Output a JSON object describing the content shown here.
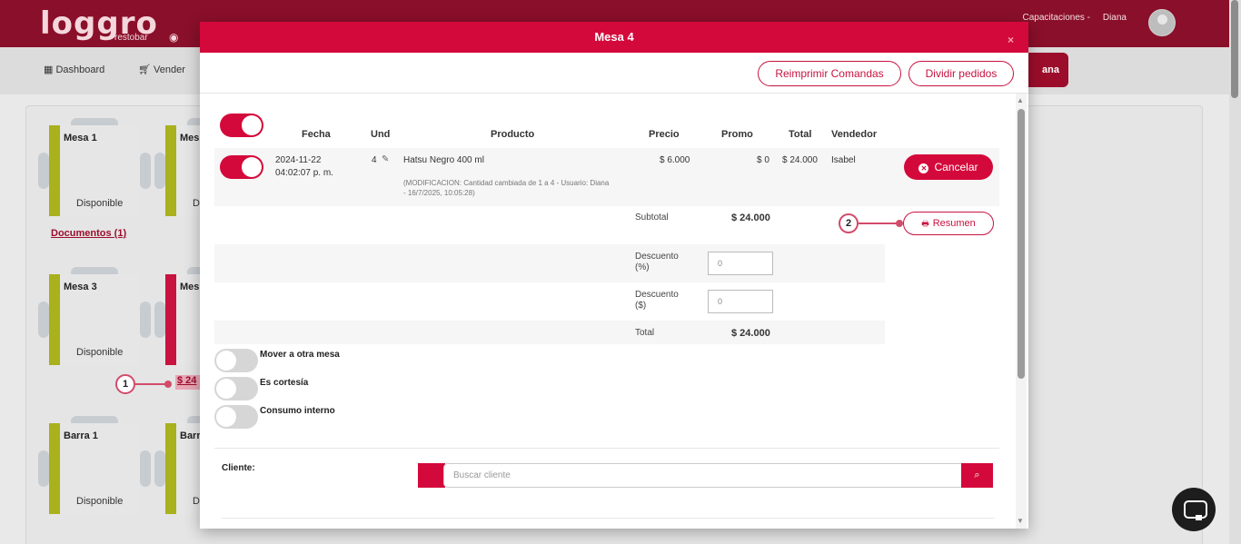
{
  "app": {
    "logo_text": "loggro",
    "logo_sub": "restobar",
    "user_prefix": "Capacitaciones -",
    "user_name": "Diana",
    "nav": {
      "dashboard": "Dashboard",
      "vender": "Vender"
    },
    "bg_button_suffix": "ana"
  },
  "tables": [
    {
      "name": "Mesa 1",
      "state": "Disponible"
    },
    {
      "name": "Mes",
      "state": "D"
    },
    {
      "name": "Mesa 3",
      "state": "Disponible"
    },
    {
      "name": "Mes",
      "state": ""
    },
    {
      "name": "Barra 1",
      "state": "Disponible"
    },
    {
      "name": "Barr",
      "state": "D"
    }
  ],
  "documents_link": "Documentos (1)",
  "partial_amount": "$ 24",
  "callouts": {
    "one": "1",
    "two": "2"
  },
  "modal": {
    "title": "Mesa 4",
    "close": "×",
    "buttons": {
      "reprint": "Reimprimir Comandas",
      "split": "Dividir pedidos"
    },
    "headers": {
      "fecha": "Fecha",
      "und": "Und",
      "producto": "Producto",
      "precio": "Precio",
      "promo": "Promo",
      "total": "Total",
      "vendedor": "Vendedor"
    },
    "row": {
      "date": "2024-11-22",
      "time": "04:02:07 p. m.",
      "und": "4",
      "product": "Hatsu Negro 400 ml",
      "note": "(MODIFICACION: Cantidad cambiada de 1 a 4 - Usuario: Diana - 16/7/2025, 10:05:28)",
      "price": "$ 6.000",
      "promo": "$ 0",
      "total": "$ 24.000",
      "seller": "Isabel",
      "cancel_label": "Cancelar"
    },
    "summary": {
      "subtotal_label": "Subtotal",
      "subtotal_value": "$ 24.000",
      "resumen_label": "Resumen",
      "discount_pct_label": "Descuento (%)",
      "discount_pct_value": "0",
      "discount_abs_label": "Descuento ($)",
      "discount_abs_value": "0",
      "total_label": "Total",
      "total_value": "$ 24.000"
    },
    "options": {
      "move": "Mover a otra mesa",
      "courtesy": "Es cortesía",
      "internal": "Consumo interno"
    },
    "client": {
      "label": "Cliente:",
      "placeholder": "Buscar cliente"
    }
  },
  "colors": {
    "brand": "#d4093b",
    "topbar": "#8a0f2a",
    "available": "#a9b11c"
  }
}
